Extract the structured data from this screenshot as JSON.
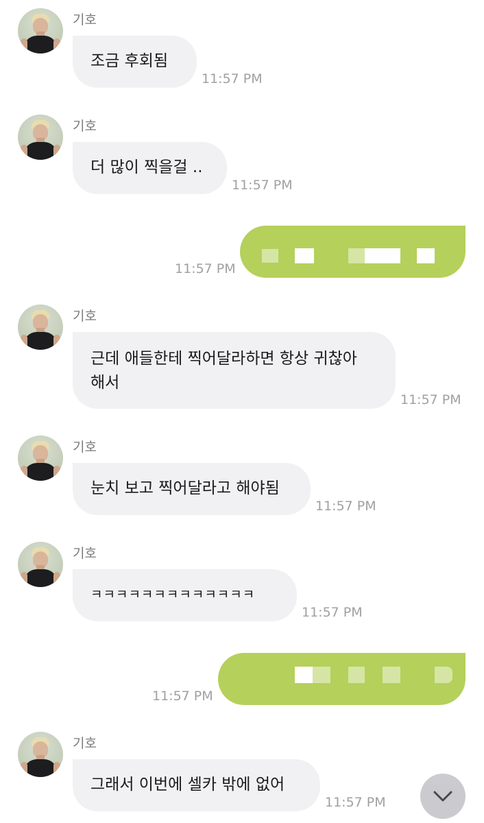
{
  "messages": [
    {
      "sender": "기호",
      "text": "조금 후회됨",
      "time": "11:57 PM"
    },
    {
      "sender": "기호",
      "text": "더 많이 찍을걸 ..",
      "time": "11:57 PM"
    },
    {
      "sender": "me",
      "text": "",
      "time": "11:57 PM"
    },
    {
      "sender": "기호",
      "text": "근데 애들한테 찍어달라하면 항상 귀찮아\n해서",
      "time": "11:57 PM"
    },
    {
      "sender": "기호",
      "text": "눈치 보고 찍어달라고 해야됨",
      "time": "11:57 PM"
    },
    {
      "sender": "기호",
      "text": "ㅋㅋㅋㅋㅋㅋㅋㅋㅋㅋㅋㅋㅋ",
      "time": "11:57 PM"
    },
    {
      "sender": "me",
      "text": "",
      "time": "11:57 PM"
    },
    {
      "sender": "기호",
      "text": "그래서 이번에 셀카 밖에 없어",
      "time": "11:57 PM"
    }
  ],
  "icons": {
    "avatar": "profile-photo",
    "scroll_down": "chevron-down-icon"
  },
  "colors": {
    "incoming_bubble": "#f1f1f4",
    "outgoing_bubble": "#b5d05b",
    "timestamp": "#a0a0a4",
    "name": "#7a7a7e"
  }
}
